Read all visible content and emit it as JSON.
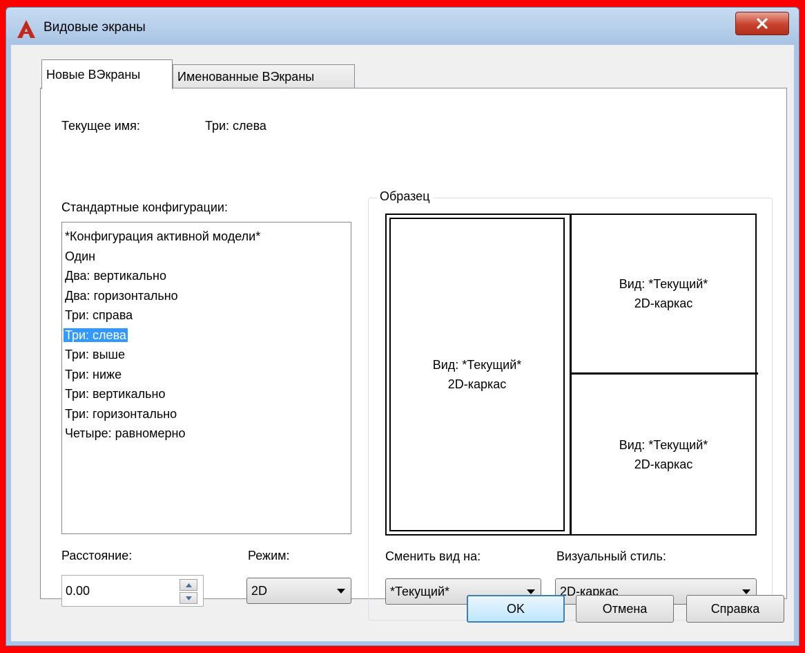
{
  "window": {
    "title": "Видовые экраны"
  },
  "tabs": [
    {
      "label": "Новые ВЭкраны"
    },
    {
      "label": "Именованные ВЭкраны"
    }
  ],
  "current_name": {
    "label": "Текущее имя:",
    "value": "Три: слева"
  },
  "configs": {
    "label": "Стандартные конфигурации:",
    "items": [
      "*Конфигурация активной модели*",
      "Один",
      "Два: вертикально",
      "Два: горизонтально",
      "Три: справа",
      "Три: слева",
      "Три: выше",
      "Три: ниже",
      "Три: вертикально",
      "Три: горизонтально",
      "Четыре: равномерно"
    ],
    "selected_index": 5
  },
  "preview": {
    "label": "Образец",
    "left": {
      "line1": "Вид: *Текущий*",
      "line2": "2D-каркас"
    },
    "top_right": {
      "line1": "Вид: *Текущий*",
      "line2": "2D-каркас"
    },
    "bottom_right": {
      "line1": "Вид: *Текущий*",
      "line2": "2D-каркас"
    }
  },
  "spacing": {
    "label": "Расстояние:",
    "value": "0.00"
  },
  "mode": {
    "label": "Режим:",
    "value": "2D"
  },
  "change_view": {
    "label": "Сменить вид на:",
    "value": "*Текущий*"
  },
  "visual_style": {
    "label": "Визуальный стиль:",
    "value": "2D-каркас"
  },
  "buttons": {
    "ok": "OK",
    "cancel": "Отмена",
    "help": "Справка"
  },
  "colors": {
    "selection": "#3399ff",
    "frame": "#ff0000",
    "titlebar": "#a9c6e6"
  }
}
